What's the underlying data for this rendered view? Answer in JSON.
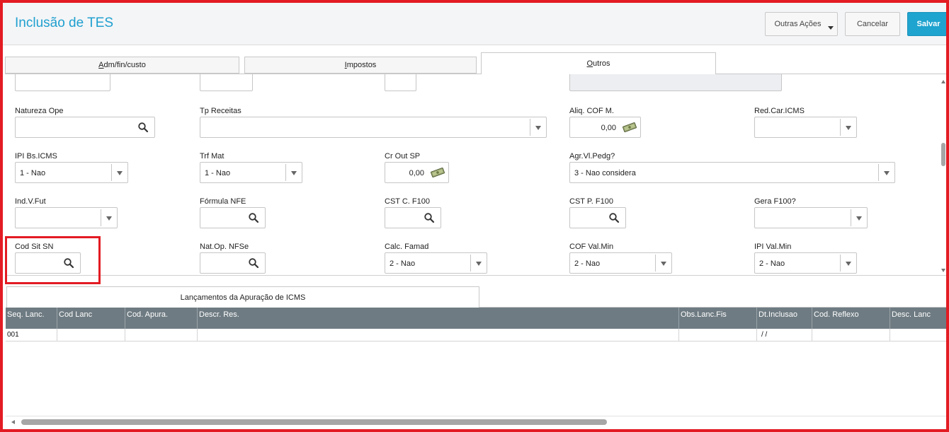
{
  "header": {
    "title": "Inclusão de TES",
    "buttons": {
      "more": "Outras Ações",
      "cancel": "Cancelar",
      "save": "Salvar"
    }
  },
  "tabs": [
    {
      "label": "Adm/fin/custo",
      "active": false
    },
    {
      "label": "Impostos",
      "active": false
    },
    {
      "label": "Outros",
      "active": true
    }
  ],
  "form": {
    "natureza_ope": {
      "label": "Natureza Ope",
      "value": ""
    },
    "tp_receitas": {
      "label": "Tp Receitas",
      "value": ""
    },
    "aliq_cof_m": {
      "label": "Aliq. COF M.",
      "value": "0,00"
    },
    "red_car_icms": {
      "label": "Red.Car.ICMS",
      "value": ""
    },
    "ipi_bs_icms": {
      "label": "IPI Bs.ICMS",
      "value": "1 - Nao"
    },
    "trf_mat": {
      "label": "Trf Mat",
      "value": "1 - Nao"
    },
    "cr_out_sp": {
      "label": "Cr Out SP",
      "value": "0,00"
    },
    "agr_vl_pedg": {
      "label": "Agr.Vl.Pedg?",
      "value": "3 - Nao considera"
    },
    "ind_v_fut": {
      "label": "Ind.V.Fut",
      "value": ""
    },
    "formula_nfe": {
      "label": "Fórmula NFE",
      "value": ""
    },
    "cst_c_f100": {
      "label": "CST C. F100",
      "value": ""
    },
    "cst_p_f100": {
      "label": "CST P. F100",
      "value": ""
    },
    "gera_f100": {
      "label": "Gera F100?",
      "value": ""
    },
    "cod_sit_sn": {
      "label": "Cod Sit SN",
      "value": ""
    },
    "nat_op_nfse": {
      "label": "Nat.Op. NFSe",
      "value": ""
    },
    "calc_famad": {
      "label": "Calc. Famad",
      "value": "2 - Nao"
    },
    "cof_val_min": {
      "label": "COF Val.Min",
      "value": "2 - Nao"
    },
    "ipi_val_min": {
      "label": "IPI Val.Min",
      "value": "2 - Nao"
    }
  },
  "grid": {
    "tab_label": "Lançamentos da Apuração de ICMS",
    "columns": [
      "Seq. Lanc.",
      "Cod Lanc",
      "Cod. Apura.",
      "Descr. Res.",
      "Obs.Lanc.Fis",
      "Dt.Inclusao",
      "Cod. Reflexo",
      "Desc. Lanc"
    ],
    "rows": [
      [
        "001",
        "",
        "",
        "",
        "",
        " /  /",
        "",
        ""
      ]
    ]
  },
  "colors": {
    "accent": "#1fa0cf",
    "highlight": "#e31b23",
    "grid_header": "#6e7b82"
  }
}
